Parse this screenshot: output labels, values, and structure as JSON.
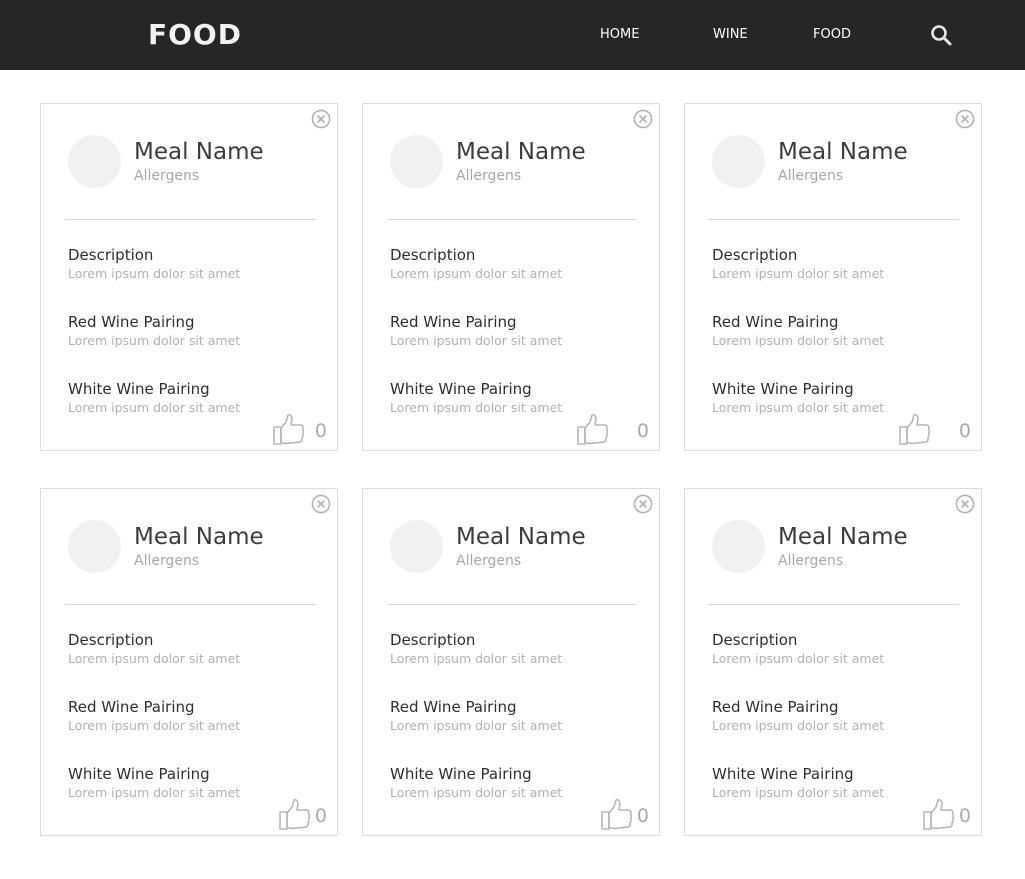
{
  "navbar": {
    "brand": "FOOD",
    "links": [
      "HOME",
      "WINE",
      "FOOD"
    ],
    "search_icon": "search-icon"
  },
  "labels": {
    "meal_name": "Meal Name",
    "allergens": "Allergens",
    "description": "Description",
    "red_wine": "Red Wine Pairing",
    "white_wine": "White Wine Pairing"
  },
  "cards": [
    {
      "meal_name": "Meal Name",
      "allergens": "Allergens",
      "description": "Lorem ipsum dolor sit amet",
      "red_wine": "Lorem ipsum dolor sit amet",
      "white_wine": "Lorem ipsum dolor sit amet",
      "likes": "0"
    },
    {
      "meal_name": "Meal Name",
      "allergens": "Allergens",
      "description": "Lorem ipsum dolor sit amet",
      "red_wine": "Lorem ipsum dolor sit amet",
      "white_wine": "Lorem ipsum dolor sit amet",
      "likes": "0"
    },
    {
      "meal_name": "Meal Name",
      "allergens": "Allergens",
      "description": "Lorem ipsum dolor sit amet",
      "red_wine": "Lorem ipsum dolor sit amet",
      "white_wine": "Lorem ipsum dolor sit amet",
      "likes": "0"
    },
    {
      "meal_name": "Meal Name",
      "allergens": "Allergens",
      "description": "Lorem ipsum dolor sit amet",
      "red_wine": "Lorem ipsum dolor sit amet",
      "white_wine": "Lorem ipsum dolor sit amet",
      "likes": "0"
    },
    {
      "meal_name": "Meal Name",
      "allergens": "Allergens",
      "description": "Lorem ipsum dolor sit amet",
      "red_wine": "Lorem ipsum dolor sit amet",
      "white_wine": "Lorem ipsum dolor sit amet",
      "likes": "0"
    },
    {
      "meal_name": "Meal Name",
      "allergens": "Allergens",
      "description": "Lorem ipsum dolor sit amet",
      "red_wine": "Lorem ipsum dolor sit amet",
      "white_wine": "Lorem ipsum dolor sit amet",
      "likes": "0"
    }
  ],
  "icons": {
    "close": "close-circle-icon",
    "like": "thumbs-up-icon"
  },
  "colors": {
    "navbar_bg": "#262626",
    "card_border": "#dcdcdc",
    "avatar_bg": "#f1f1f1",
    "muted_text": "#b2b2b2"
  }
}
